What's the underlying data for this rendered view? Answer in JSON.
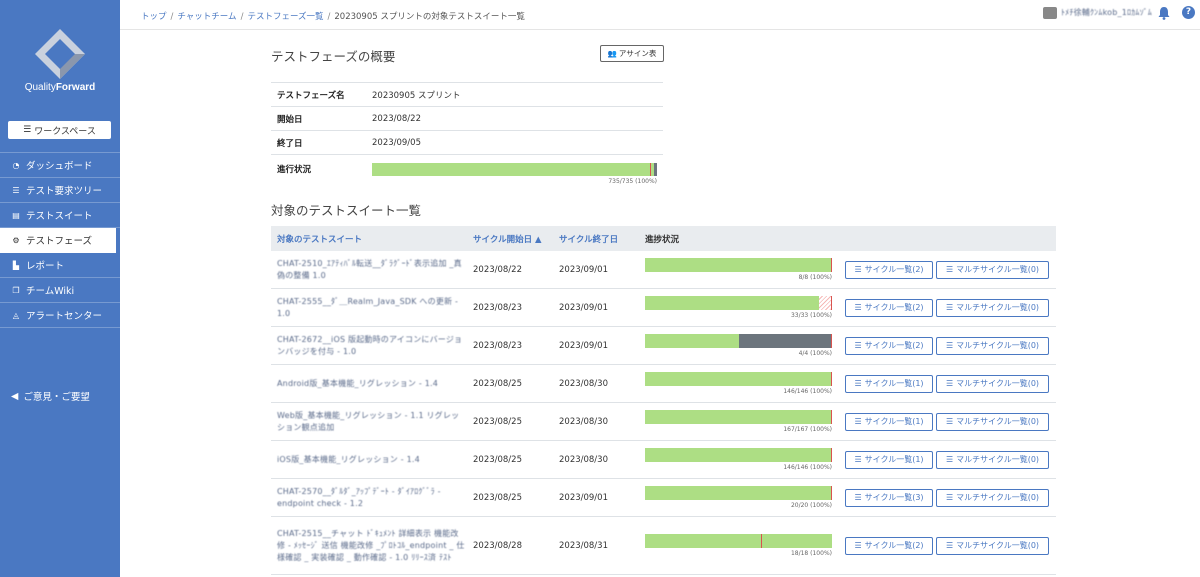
{
  "sidebar": {
    "logo": {
      "quality": "Quality",
      "forward": "Forward"
    },
    "workspace_label": "ワークスペース",
    "items": [
      {
        "label": "ダッシュボード",
        "icon": "gauge-icon"
      },
      {
        "label": "テスト要求ツリー",
        "icon": "list-icon"
      },
      {
        "label": "テストスイート",
        "icon": "document-icon"
      },
      {
        "label": "テストフェーズ",
        "icon": "phase-icon",
        "active": true
      },
      {
        "label": "レポート",
        "icon": "chart-icon"
      },
      {
        "label": "チームWiki",
        "icon": "wiki-icon"
      },
      {
        "label": "アラートセンター",
        "icon": "bell-icon"
      }
    ],
    "feedback_label": "ご意見・ご要望"
  },
  "header": {
    "breadcrumb": [
      "トップ",
      "チャットチーム",
      "テストフェーズ一覧",
      "20230905 スプリントの対象テストスイート一覧"
    ],
    "user_name": "ﾄﾒﾁ徐輔ｸﾝﾑkob_1ﾛｶﾑｿﾞﾑ"
  },
  "overview": {
    "title": "テストフェーズの概要",
    "assign_label": "アサイン表",
    "rows": [
      {
        "key": "テストフェーズ名",
        "value": "20230905 スプリント"
      },
      {
        "key": "開始日",
        "value": "2023/08/22"
      },
      {
        "key": "終了日",
        "value": "2023/09/05"
      }
    ],
    "progress_key": "進行状況",
    "progress_caption": "735/735 (100%)",
    "progress_fraction": 1.0
  },
  "suites": {
    "title": "対象のテストスイート一覧",
    "columns": {
      "name": "対象のテストスイート",
      "start": "サイクル開始日 ▲",
      "end": "サイクル終了日",
      "progress": "進捗状況"
    },
    "rows": [
      {
        "name": "CHAT-2510_ｴｱﾃｨﾊﾞﾙ転送__ﾀﾞﾗｸﾞｰﾄﾞ表示追加 _真偽の整備 1.0",
        "start": "2023/08/22",
        "end": "2023/09/01",
        "caption": "8/8 (100%)",
        "green": 1.0,
        "gray": 0,
        "hatch": 0,
        "mark": 1.0,
        "cycle": "サイクル一覧(2)",
        "multi": "マルチサイクル一覧(0)"
      },
      {
        "name": "CHAT-2555__ﾀﾞ＿Realm_Java_SDK への更新 - 1.0",
        "start": "2023/08/23",
        "end": "2023/09/01",
        "caption": "33/33 (100%)",
        "green": 0.93,
        "gray": 0,
        "hatch": 0.07,
        "mark": 1.0,
        "cycle": "サイクル一覧(2)",
        "multi": "マルチサイクル一覧(0)"
      },
      {
        "name": "CHAT-2672__iOS 版起動時のアイコンにバージョンバッジを付与 - 1.0",
        "start": "2023/08/23",
        "end": "2023/09/01",
        "caption": "4/4 (100%)",
        "green": 0.5,
        "gray": 0.5,
        "hatch": 0,
        "mark": 1.0,
        "cycle": "サイクル一覧(2)",
        "multi": "マルチサイクル一覧(0)"
      },
      {
        "name": "Android版_基本機能_リグレッション - 1.4",
        "start": "2023/08/25",
        "end": "2023/08/30",
        "caption": "146/146 (100%)",
        "green": 1.0,
        "gray": 0,
        "hatch": 0,
        "mark": 1.0,
        "cycle": "サイクル一覧(1)",
        "multi": "マルチサイクル一覧(0)"
      },
      {
        "name": "Web版_基本機能_リグレッション - 1.1 リグレッション観点追加",
        "start": "2023/08/25",
        "end": "2023/08/30",
        "caption": "167/167 (100%)",
        "green": 1.0,
        "gray": 0,
        "hatch": 0,
        "mark": 1.0,
        "cycle": "サイクル一覧(1)",
        "multi": "マルチサイクル一覧(0)"
      },
      {
        "name": "iOS版_基本機能_リグレッション - 1.4",
        "start": "2023/08/25",
        "end": "2023/08/30",
        "caption": "146/146 (100%)",
        "green": 1.0,
        "gray": 0,
        "hatch": 0,
        "mark": 1.0,
        "cycle": "サイクル一覧(1)",
        "multi": "マルチサイクル一覧(0)"
      },
      {
        "name": "CHAT-2570__ﾀﾞﾙﾀﾞ_ｱｯﾌﾟﾃﾞｰﾄ - ﾀﾞｲｱﾛｸﾞﾞﾗ - endpoint check - 1.2",
        "start": "2023/08/25",
        "end": "2023/09/01",
        "caption": "20/20 (100%)",
        "green": 1.0,
        "gray": 0,
        "hatch": 0,
        "mark": 1.0,
        "cycle": "サイクル一覧(3)",
        "multi": "マルチサイクル一覧(0)"
      },
      {
        "name": "CHAT-2515__チャット ﾄﾞｷｭﾒﾝﾄ 詳細表示 機能改修 - ﾒｯｾｰｼﾞ 送信 機能改修 _ﾌﾟﾛﾄｺﾙ_endpoint _ 仕様確認 _ 実装確認 _ 動作確認 - 1.0 ﾘﾘｰｽ済 ﾃｽﾄ",
        "start": "2023/08/28",
        "end": "2023/08/31",
        "caption": "18/18 (100%)",
        "green": 1.0,
        "gray": 0,
        "hatch": 0,
        "mark": 0.62,
        "cycle": "サイクル一覧(2)",
        "multi": "マルチサイクル一覧(0)"
      }
    ]
  },
  "colors": {
    "accent": "#4a78c2",
    "progress_green": "#adde84",
    "progress_gray": "#6c757d",
    "marker_red": "#d9534f"
  }
}
